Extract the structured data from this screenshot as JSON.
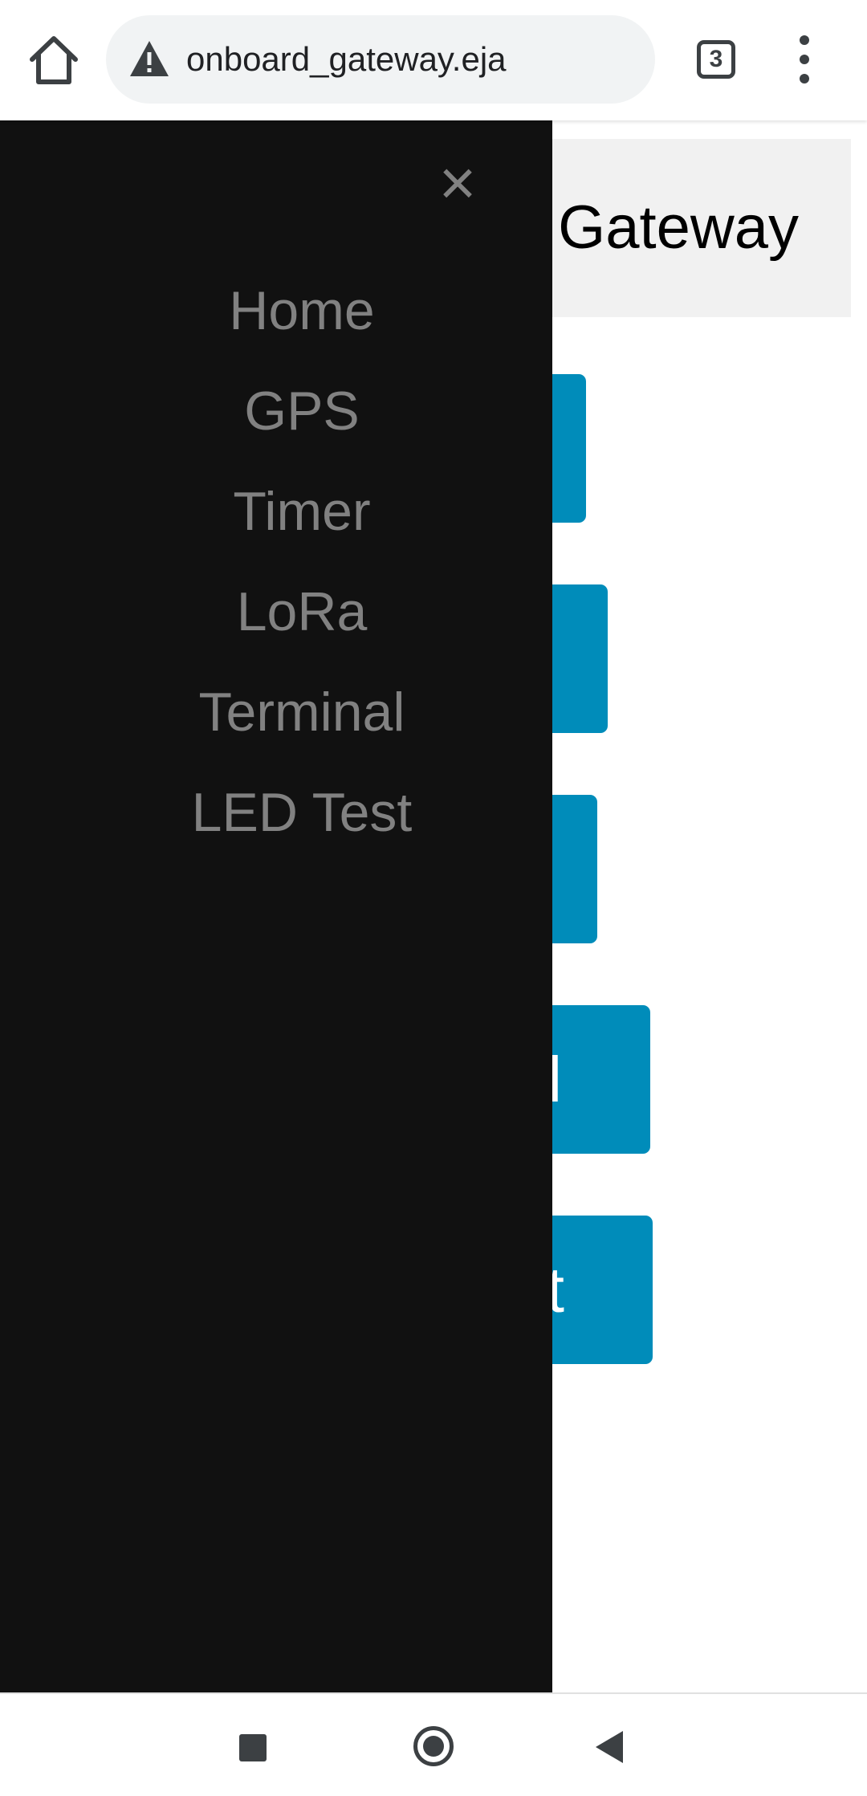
{
  "browser": {
    "url": "onboard_gateway.eja",
    "tab_count": "3",
    "icons": {
      "home": "home-icon",
      "warning": "warning-icon",
      "menu": "more-vert-icon"
    }
  },
  "page": {
    "title": "Gateway",
    "buttons": [
      "",
      "",
      "",
      "l",
      "t"
    ],
    "button_color": "#008cba",
    "header_bg": "#f1f1f1"
  },
  "sidenav": {
    "close_label": "×",
    "items": [
      "Home",
      "GPS",
      "Timer",
      "LoRa",
      "Terminal",
      "LED Test"
    ],
    "bg_color": "#111111",
    "text_color": "#818181"
  },
  "system_nav": {
    "icons": [
      "recents-icon",
      "home-icon",
      "back-icon"
    ]
  }
}
